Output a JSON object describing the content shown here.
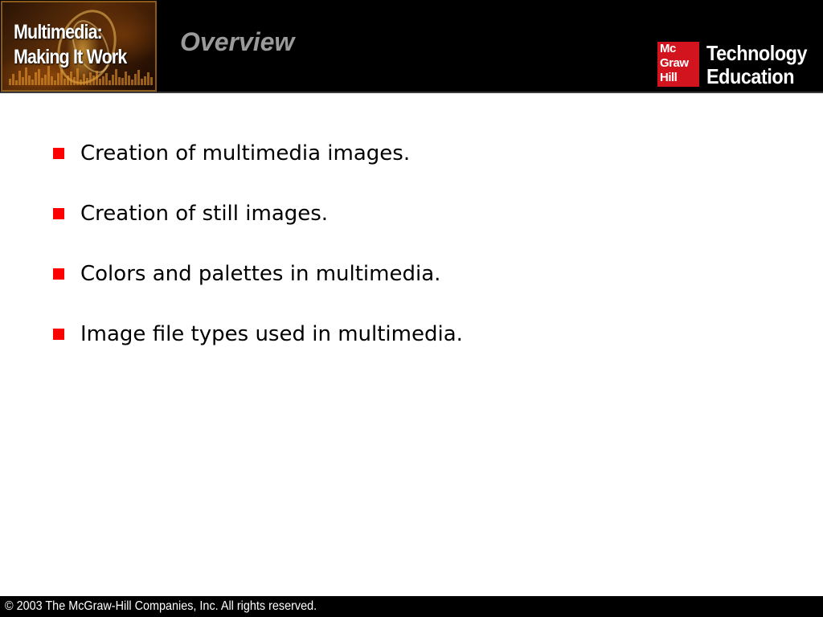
{
  "header": {
    "book_logo": {
      "line1": "Multimedia:",
      "line2": "Making It Work"
    },
    "title": "Overview",
    "publisher": {
      "mark_line1": "Mc",
      "mark_line2": "Graw",
      "mark_line3": "Hill",
      "name_line1": "Technology",
      "name_line2": "Education",
      "mark_color": "#d2141e"
    }
  },
  "bullets": [
    {
      "text": "Creation of multimedia images."
    },
    {
      "text": "Creation of still images."
    },
    {
      "text": "Colors and palettes in multimedia."
    },
    {
      "text": "Image file types used in multimedia."
    }
  ],
  "bullet_color": "#ff0000",
  "footer": {
    "copyright": "© 2003 The McGraw-Hill Companies, Inc. All rights reserved."
  }
}
